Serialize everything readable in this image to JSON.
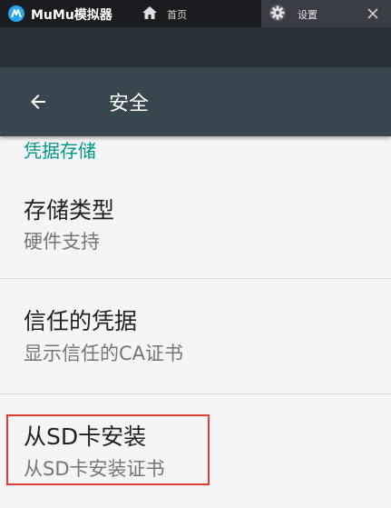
{
  "emulator": {
    "app_name": "MuMu模拟器",
    "tabs": [
      {
        "label": "首页",
        "icon": "home-icon"
      },
      {
        "label": "设置",
        "icon": "gear-icon"
      }
    ],
    "close_icon": "close-icon"
  },
  "app_bar": {
    "title": "安全",
    "back_icon": "arrow-left-icon"
  },
  "content": {
    "section_header": "凭据存储",
    "items": [
      {
        "title": "存储类型",
        "summary": "硬件支持"
      },
      {
        "title": "信任的凭据",
        "summary": "显示信任的CA证书"
      },
      {
        "title": "从SD卡安装",
        "summary": "从SD卡安装证书",
        "highlighted": true
      }
    ]
  },
  "colors": {
    "emulator_bar": "#1b1c20",
    "status_bar": "#263238",
    "app_bar": "#37474f",
    "accent": "#009688",
    "background": "#f5f5f5",
    "highlight": "#e53935"
  }
}
